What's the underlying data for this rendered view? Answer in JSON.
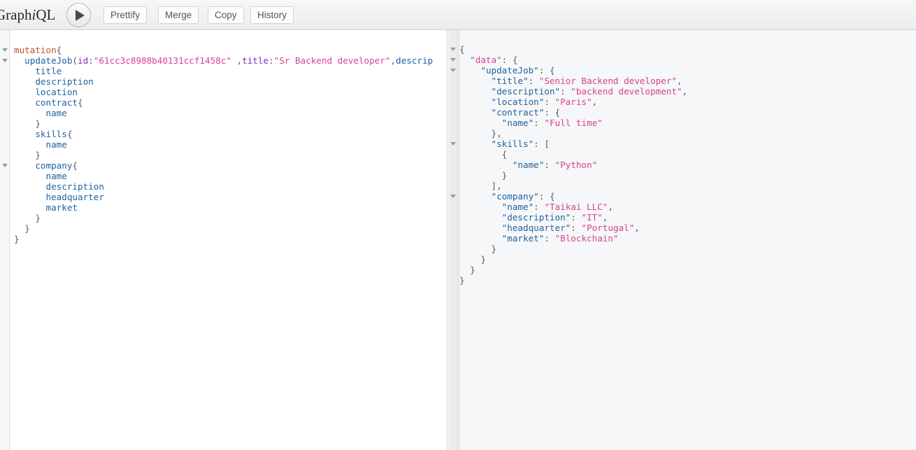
{
  "toolbar": {
    "logo_prefix": "Graph",
    "logo_i": "i",
    "logo_suffix": "QL",
    "execute_label": "▶",
    "prettify_label": "Prettify",
    "merge_label": "Merge",
    "copy_label": "Copy",
    "history_label": "History"
  },
  "query_editor": {
    "lines": [
      {
        "text": "mutation{",
        "fold": true
      },
      {
        "text": "  updateJob(id:\"61cc3c8988b40131ccf1458c\" ,title:\"Sr Backend developer\",descrip",
        "fold": true
      },
      {
        "text": "    title",
        "fold": false
      },
      {
        "text": "    description",
        "fold": false
      },
      {
        "text": "    location",
        "fold": false
      },
      {
        "text": "    contract{",
        "fold": false
      },
      {
        "text": "      name",
        "fold": false
      },
      {
        "text": "    }",
        "fold": false
      },
      {
        "text": "    skills{",
        "fold": false
      },
      {
        "text": "      name",
        "fold": false
      },
      {
        "text": "    }",
        "fold": false
      },
      {
        "text": "    company{",
        "fold": true
      },
      {
        "text": "      name",
        "fold": false
      },
      {
        "text": "      description",
        "fold": false
      },
      {
        "text": "      headquarter",
        "fold": false
      },
      {
        "text": "      market",
        "fold": false
      },
      {
        "text": "    }",
        "fold": false
      },
      {
        "text": "  }",
        "fold": false
      },
      {
        "text": "}",
        "fold": false
      }
    ],
    "mutation_keyword": "mutation",
    "operation_name": "updateJob",
    "arguments": {
      "id": "61cc3c8988b40131ccf1458c",
      "title": "Sr Backend developer",
      "description_truncated": "descrip"
    },
    "selected_fields": [
      "title",
      "description",
      "location",
      "contract",
      "skills",
      "company"
    ],
    "contract_fields": [
      "name"
    ],
    "skills_fields": [
      "name"
    ],
    "company_fields": [
      "name",
      "description",
      "headquarter",
      "market"
    ]
  },
  "response": {
    "data": {
      "updateJob": {
        "title": "Senior Backend developer",
        "description": "backend development",
        "location": "Paris",
        "contract": {
          "name": "Full time"
        },
        "skills": [
          {
            "name": "Python"
          }
        ],
        "company": {
          "name": "Taikai LLC",
          "description": "IT",
          "headquarter": "Portugal",
          "market": "Blockchain"
        }
      }
    },
    "lines": [
      {
        "text": "{",
        "fold": true
      },
      {
        "text": "  \"data\": {",
        "fold": true
      },
      {
        "text": "    \"updateJob\": {",
        "fold": true
      },
      {
        "text": "      \"title\": \"Senior Backend developer\",",
        "fold": false
      },
      {
        "text": "      \"description\": \"backend development\",",
        "fold": false
      },
      {
        "text": "      \"location\": \"Paris\",",
        "fold": false
      },
      {
        "text": "      \"contract\": {",
        "fold": false
      },
      {
        "text": "        \"name\": \"Full time\"",
        "fold": false
      },
      {
        "text": "      },",
        "fold": false
      },
      {
        "text": "      \"skills\": [",
        "fold": true
      },
      {
        "text": "        {",
        "fold": false
      },
      {
        "text": "          \"name\": \"Python\"",
        "fold": false
      },
      {
        "text": "        }",
        "fold": false
      },
      {
        "text": "      ],",
        "fold": false
      },
      {
        "text": "      \"company\": {",
        "fold": true
      },
      {
        "text": "        \"name\": \"Taikai LLC\",",
        "fold": false
      },
      {
        "text": "        \"description\": \"IT\",",
        "fold": false
      },
      {
        "text": "        \"headquarter\": \"Portugal\",",
        "fold": false
      },
      {
        "text": "        \"market\": \"Blockchain\"",
        "fold": false
      },
      {
        "text": "      }",
        "fold": false
      },
      {
        "text": "    }",
        "fold": false
      },
      {
        "text": "  }",
        "fold": false
      },
      {
        "text": "}",
        "fold": false
      }
    ]
  },
  "colors": {
    "keyword": "#c2512c",
    "field": "#1f61a0",
    "argument": "#8b2bb9",
    "string": "#d64292",
    "punctuation": "#555a63",
    "query_bg": "#ffffff",
    "result_bg": "#f6f7f8",
    "toolbar_bg": "#ececec"
  }
}
